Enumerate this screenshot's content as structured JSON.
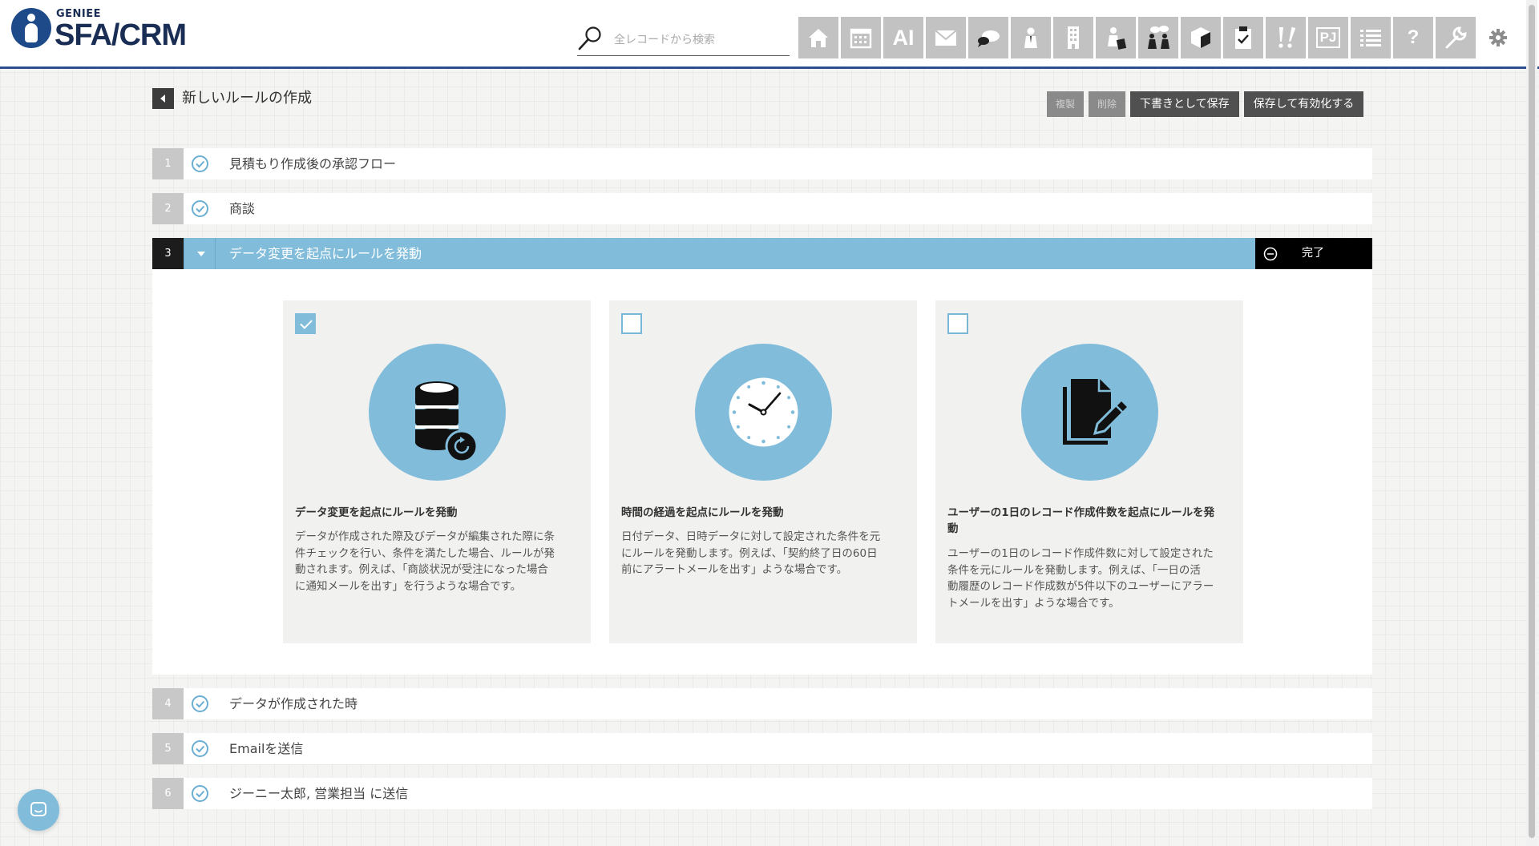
{
  "app": {
    "logo_small": "GENIEE",
    "logo_big": "SFA/CRM"
  },
  "search": {
    "placeholder": "全レコードから検索"
  },
  "nav": {
    "items": [
      {
        "name": "home-icon"
      },
      {
        "name": "calendar-icon"
      },
      {
        "name": "ai-icon",
        "text": "AI"
      },
      {
        "name": "mail-icon"
      },
      {
        "name": "chat-icon"
      },
      {
        "name": "contact-icon"
      },
      {
        "name": "building-icon"
      },
      {
        "name": "deal-icon"
      },
      {
        "name": "meeting-icon"
      },
      {
        "name": "product-icon"
      },
      {
        "name": "task-icon"
      },
      {
        "name": "report-icon"
      },
      {
        "name": "project-icon",
        "text": "PJ"
      },
      {
        "name": "list-icon"
      },
      {
        "name": "help-icon",
        "text": "?"
      },
      {
        "name": "wrench-icon"
      },
      {
        "name": "settings-icon"
      }
    ]
  },
  "page": {
    "title": "新しいルールの作成",
    "actions": {
      "duplicate": "複製",
      "delete": "削除",
      "save_draft": "下書きとして保存",
      "save_activate": "保存して有効化する"
    }
  },
  "steps": [
    {
      "num": "1",
      "label": "見積もり作成後の承認フロー"
    },
    {
      "num": "2",
      "label": "商談"
    },
    {
      "num": "3",
      "label": "データ変更を起点にルールを発動",
      "complete": "完了"
    },
    {
      "num": "4",
      "label": "データが作成された時"
    },
    {
      "num": "5",
      "label": "Emailを送信"
    },
    {
      "num": "6",
      "label": "ジーニー太郎, 営業担当 に送信"
    }
  ],
  "cards": [
    {
      "checked": true,
      "icon": "database-refresh-icon",
      "title": "データ変更を起点にルールを発動",
      "desc_lines": [
        "データが作成された際及びデータが編集された際に条",
        "件チェックを行い、条件を満たした場合、ルールが発",
        "動されます。例えば、「商談状況が受注になった場合",
        "に通知メールを出す」を行うような場合です。"
      ]
    },
    {
      "checked": false,
      "icon": "clock-icon",
      "title": "時間の経過を起点にルールを発動",
      "desc_lines": [
        "日付データ、日時データに対して設定された条件を元",
        "にルールを発動します。例えば、「契約終了日の60日",
        "前にアラートメールを出す」ような場合です。"
      ]
    },
    {
      "checked": false,
      "icon": "document-edit-icon",
      "title_lines": [
        "ユーザーの1日のレコード作成件数を起点にルールを発",
        "動"
      ],
      "desc_lines": [
        "ユーザーの1日のレコード作成件数に対して設定された",
        "条件を元にルールを発動します。例えば、「一日の活",
        "動履歴のレコード作成数が5件以下のユーザーにアラー",
        "トメールを出す」ような場合です。"
      ]
    }
  ],
  "colors": {
    "accent": "#82bcdb",
    "header_border": "#2e4f8f",
    "logo": "#1e4a8a"
  }
}
